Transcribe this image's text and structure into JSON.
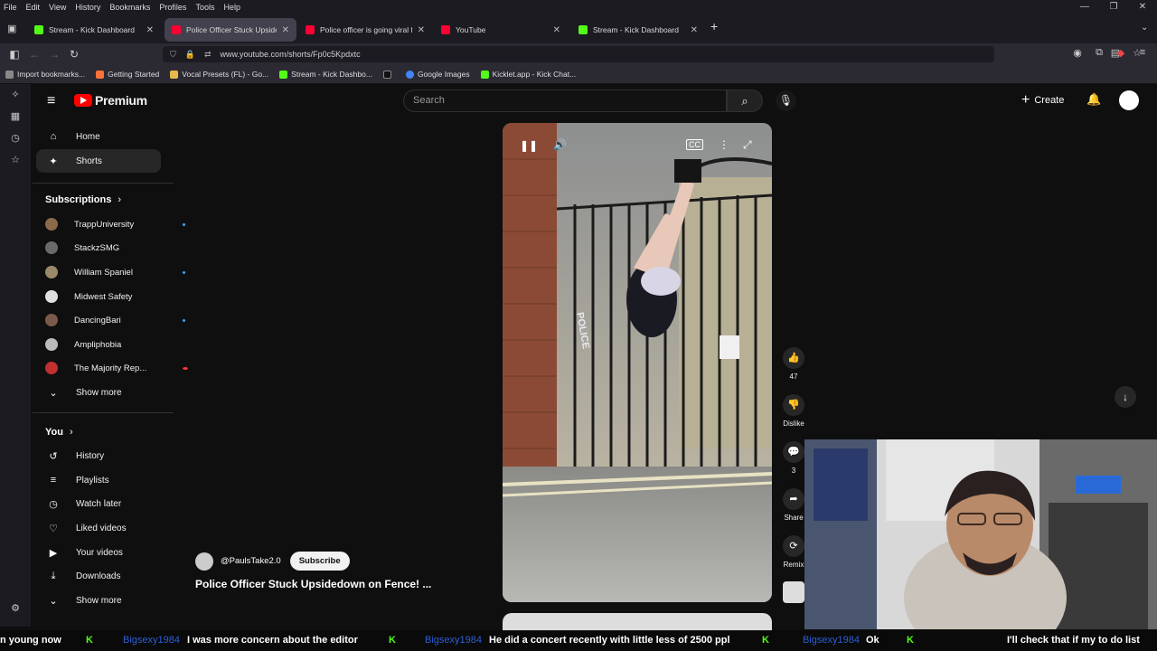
{
  "browser": {
    "menu": [
      "File",
      "Edit",
      "View",
      "History",
      "Bookmarks",
      "Profiles",
      "Tools",
      "Help"
    ],
    "tabs": [
      {
        "title": "Stream - Kick Dashboard",
        "color": "#53fc18",
        "active": false
      },
      {
        "title": "Police Officer Stuck Upside",
        "color": "#ff0033",
        "active": true
      },
      {
        "title": "Police officer is going viral for l",
        "color": "#ff0033",
        "active": false
      },
      {
        "title": "YouTube",
        "color": "#ff0033",
        "active": false
      },
      {
        "title": "Stream - Kick Dashboard",
        "color": "#53fc18",
        "active": false
      }
    ],
    "url": "www.youtube.com/shorts/Fp0c5Kpdxtc",
    "bookmarks": [
      {
        "label": "Import bookmarks...",
        "color": "#888888"
      },
      {
        "label": "Getting Started",
        "color": "#ff7139"
      },
      {
        "label": "Vocal Presets (FL) - Go...",
        "color": "#e8b84a"
      },
      {
        "label": "Stream - Kick Dashbo...",
        "color": "#53fc18"
      },
      {
        "label": "",
        "color": "#111111"
      },
      {
        "label": "Google Images",
        "color": "#4285f4"
      },
      {
        "label": "Kicklet.app - Kick Chat...",
        "color": "#53fc18"
      }
    ]
  },
  "youtube": {
    "logo_text": "Premium",
    "search_placeholder": "Search",
    "create_label": "Create",
    "nav": [
      {
        "label": "Home",
        "icon": "home-icon",
        "glyph": "⌂",
        "active": false
      },
      {
        "label": "Shorts",
        "icon": "shorts-icon",
        "glyph": "✦",
        "active": true
      }
    ],
    "subscriptions_title": "Subscriptions",
    "subscriptions": [
      {
        "name": "TrappUniversity",
        "color": "#8a6a4a",
        "live": true
      },
      {
        "name": "StackzSMG",
        "color": "#6a6a6a",
        "live": false
      },
      {
        "name": "William Spaniel",
        "color": "#9a8a6a",
        "live": true
      },
      {
        "name": "Midwest Safety",
        "color": "#e0e0e0",
        "live": false
      },
      {
        "name": "DancingBari",
        "color": "#7a5a4a",
        "live": true
      },
      {
        "name": "Ampliphobia",
        "color": "#bbbbbb",
        "live": false
      },
      {
        "name": "The Majority Rep...",
        "color": "#c03030",
        "live": true
      }
    ],
    "show_more": "Show more",
    "you_title": "You",
    "you_items": [
      {
        "label": "History",
        "glyph": "↺",
        "icon": "history-icon"
      },
      {
        "label": "Playlists",
        "glyph": "≡",
        "icon": "playlists-icon"
      },
      {
        "label": "Watch later",
        "glyph": "◷",
        "icon": "watch-later-icon"
      },
      {
        "label": "Liked videos",
        "glyph": "👍",
        "icon": "liked-icon"
      },
      {
        "label": "Your videos",
        "glyph": "▶",
        "icon": "your-videos-icon"
      },
      {
        "label": "Downloads",
        "glyph": "⤓",
        "icon": "downloads-icon"
      }
    ],
    "video": {
      "channel": "@PaulsTake2.0",
      "subscribe": "Subscribe",
      "title": "Police Officer Stuck Upsidedown on Fence! ..."
    },
    "actions": {
      "likes": "47",
      "dislike": "Dislike",
      "comments": "3",
      "share": "Share",
      "remix": "Remix"
    }
  },
  "overlay": {
    "police_text": "POLICE",
    "ticker": [
      {
        "text": "n young now",
        "kind": "msg"
      },
      {
        "text": "Bigsexy1984",
        "kind": "user"
      },
      {
        "text": "I was more concern about the editor",
        "kind": "msg"
      },
      {
        "text": "Bigsexy1984",
        "kind": "user"
      },
      {
        "text": "He did a concert recently with little less of 2500 ppl",
        "kind": "msg"
      },
      {
        "text": "Bigsexy1984",
        "kind": "user"
      },
      {
        "text": "Ok",
        "kind": "msg"
      },
      {
        "text": "I'll check that if my to do list",
        "kind": "msg"
      }
    ]
  }
}
